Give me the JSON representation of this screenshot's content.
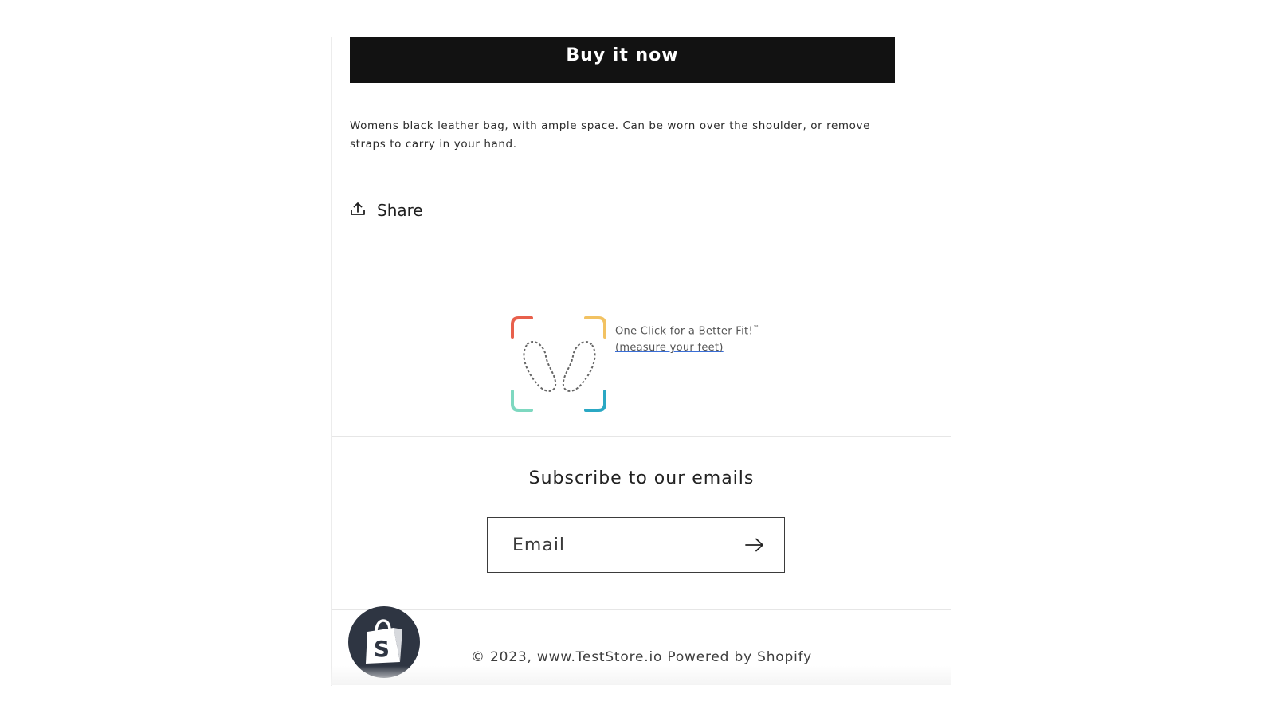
{
  "product": {
    "buy_now_label": "Buy it now",
    "description": "Womens black leather bag, with ample space. Can be worn over the shoulder, or remove straps to carry in your hand.",
    "share_label": "Share",
    "share_icon": "share-upload-icon"
  },
  "fit_widget": {
    "icon": "feet-measure-icon",
    "link_line1": "One Click for a Better Fit!",
    "trademark": "™",
    "link_line2": "(measure your feet)",
    "corner_colors": [
      "#e8604c",
      "#f2c262",
      "#7ed8c0",
      "#2aa8c4"
    ]
  },
  "newsletter": {
    "title": "Subscribe to our emails",
    "email_placeholder": "Email",
    "submit_icon": "arrow-right-icon"
  },
  "footer": {
    "copyright": "© 2023, www.TestStore.io Powered by Shopify",
    "badge_icon": "shopify-bag-icon",
    "badge_color": "#2e3542"
  },
  "colors": {
    "button_bg": "#121212",
    "button_text": "#ffffff"
  }
}
